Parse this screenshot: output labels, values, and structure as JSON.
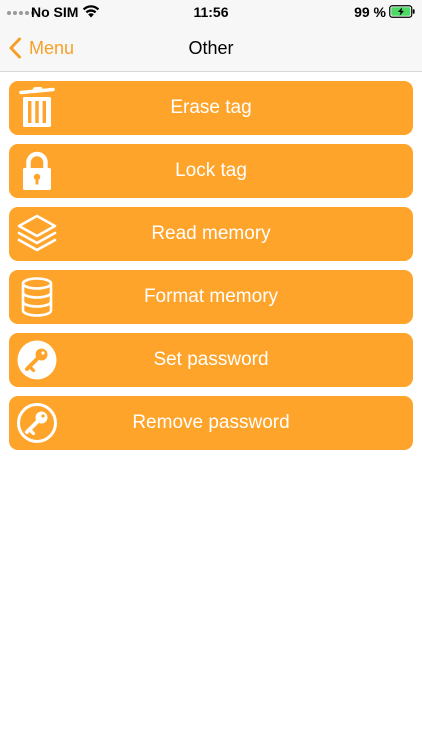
{
  "status_bar": {
    "carrier": "No SIM",
    "time": "11:56",
    "battery": "99 %"
  },
  "nav": {
    "back_label": "Menu",
    "title": "Other"
  },
  "actions": [
    {
      "label": "Erase tag",
      "icon": "trash-icon"
    },
    {
      "label": "Lock tag",
      "icon": "lock-icon"
    },
    {
      "label": "Read memory",
      "icon": "layers-icon"
    },
    {
      "label": "Format memory",
      "icon": "database-icon"
    },
    {
      "label": "Set password",
      "icon": "key-icon"
    },
    {
      "label": "Remove password",
      "icon": "key-outline-icon"
    }
  ],
  "colors": {
    "accent": "#ffa42a",
    "nav_tint": "#f7a029",
    "battery_green": "#4cd964"
  }
}
